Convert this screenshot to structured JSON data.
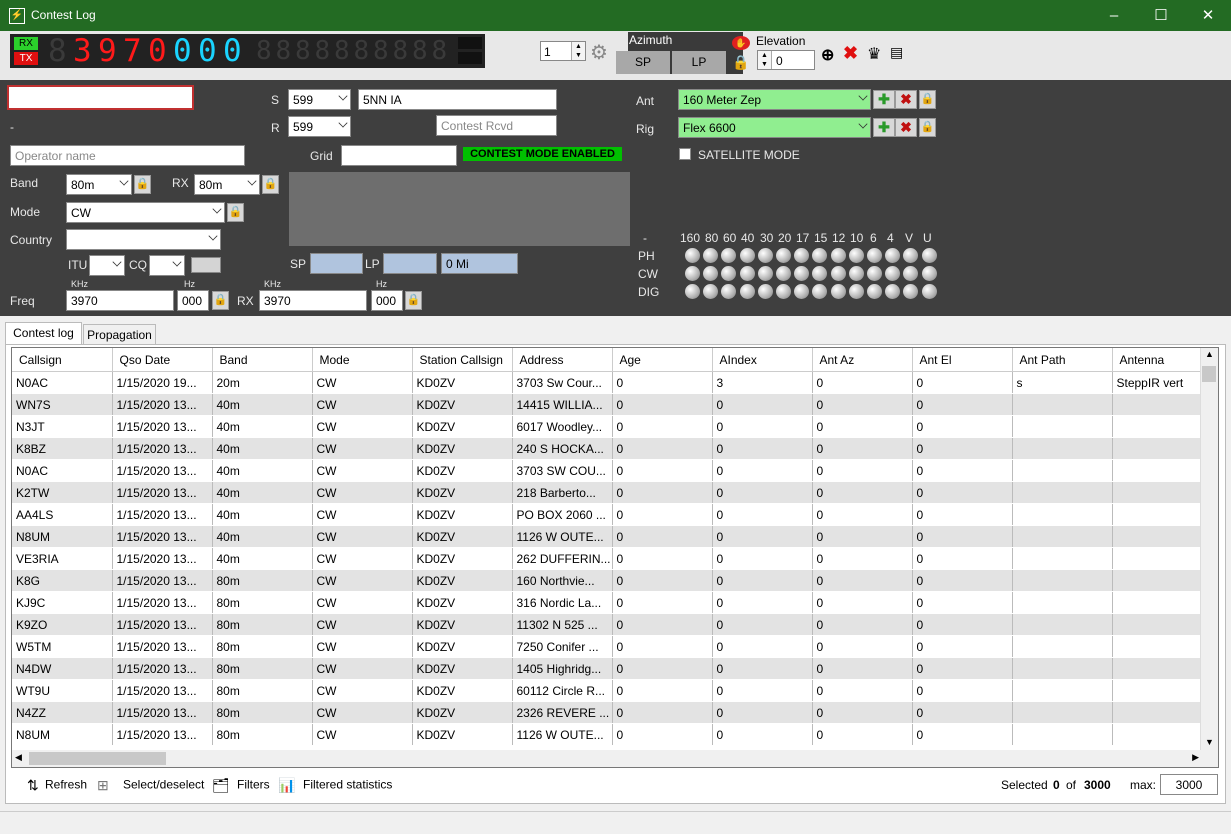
{
  "window": {
    "title": "Contest Log",
    "minimize": "–",
    "maximize": "☐",
    "close": "✕"
  },
  "vfo": {
    "rx_label": "RX",
    "tx_label": "TX",
    "main_digits": [
      "8",
      "3",
      "9",
      "7",
      "0",
      "0",
      "0",
      "0"
    ],
    "main_digit_colors": [
      "off",
      "red",
      "red",
      "red",
      "red",
      "cyan",
      "cyan",
      "cyan"
    ],
    "sub_digits": [
      "8",
      "8",
      "8",
      "8",
      "8",
      "8",
      "8",
      "8",
      "8",
      "8"
    ]
  },
  "toolbar": {
    "rotor_value": "1",
    "azimuth_label": "Azimuth",
    "sp_label": "SP",
    "lp_label": "LP",
    "elevation_label": "Elevation",
    "elevation_value": "0"
  },
  "entry": {
    "callsign_value": "",
    "dash_label": "-",
    "operator_placeholder": "Operator name",
    "band_label": "Band",
    "band_value": "80m",
    "rx_label": "RX",
    "rx_band_value": "80m",
    "mode_label": "Mode",
    "mode_value": "CW",
    "country_label": "Country",
    "country_value": "",
    "itu_label": "ITU",
    "cq_label": "CQ",
    "freq_label": "Freq",
    "khz_label": "KHz",
    "hz_label": "Hz",
    "freq_khz": "3970",
    "freq_hz": "000",
    "rx_freq_label": "RX",
    "rx_freq_khz": "3970",
    "rx_freq_hz": "000"
  },
  "report": {
    "s_label": "S",
    "s_value": "599",
    "r_label": "R",
    "r_value": "599",
    "exchange_sent": "5NN IA",
    "exchange_rcvd_placeholder": "Contest Rcvd",
    "grid_label": "Grid",
    "grid_value": "",
    "contest_mode": "CONTEST MODE ENABLED",
    "sp_label": "SP",
    "lp_label": "LP",
    "distance": "0 Mi"
  },
  "station": {
    "ant_label": "Ant",
    "ant_value": "160 Meter Zep",
    "rig_label": "Rig",
    "rig_value": "Flex 6600",
    "satellite_label": "SATELLITE MODE"
  },
  "band_matrix": {
    "dash": "-",
    "bands": [
      "160",
      "80",
      "60",
      "40",
      "30",
      "20",
      "17",
      "15",
      "12",
      "10",
      "6",
      "4",
      "V",
      "U"
    ],
    "modes": [
      "PH",
      "CW",
      "DIG"
    ]
  },
  "tabs": [
    {
      "label": "Contest log"
    },
    {
      "label": "Propagation"
    }
  ],
  "grid": {
    "columns": [
      "Callsign",
      "Qso Date",
      "Band",
      "Mode",
      "Station Callsign",
      "Address",
      "Age",
      "AIndex",
      "Ant Az",
      "Ant El",
      "Ant Path",
      "Antenna"
    ],
    "rows": [
      [
        "N0AC",
        "1/15/2020 19...",
        "20m",
        "CW",
        "KD0ZV",
        "3703 Sw Cour...",
        "0",
        "3",
        "0",
        "0",
        "s",
        "SteppIR vert"
      ],
      [
        "WN7S",
        "1/15/2020 13...",
        "40m",
        "CW",
        "KD0ZV",
        "14415 WILLIA...",
        "0",
        "0",
        "0",
        "0",
        "",
        ""
      ],
      [
        "N3JT",
        "1/15/2020 13...",
        "40m",
        "CW",
        "KD0ZV",
        "6017 Woodley...",
        "0",
        "0",
        "0",
        "0",
        "",
        ""
      ],
      [
        "K8BZ",
        "1/15/2020 13...",
        "40m",
        "CW",
        "KD0ZV",
        "240 S HOCKA...",
        "0",
        "0",
        "0",
        "0",
        "",
        ""
      ],
      [
        "N0AC",
        "1/15/2020 13...",
        "40m",
        "CW",
        "KD0ZV",
        "3703 SW COU...",
        "0",
        "0",
        "0",
        "0",
        "",
        ""
      ],
      [
        "K2TW",
        "1/15/2020 13...",
        "40m",
        "CW",
        "KD0ZV",
        "218 Barberto...",
        "0",
        "0",
        "0",
        "0",
        "",
        ""
      ],
      [
        "AA4LS",
        "1/15/2020 13...",
        "40m",
        "CW",
        "KD0ZV",
        "PO BOX 2060 ...",
        "0",
        "0",
        "0",
        "0",
        "",
        ""
      ],
      [
        "N8UM",
        "1/15/2020 13...",
        "40m",
        "CW",
        "KD0ZV",
        "1126 W OUTE...",
        "0",
        "0",
        "0",
        "0",
        "",
        ""
      ],
      [
        "VE3RIA",
        "1/15/2020 13...",
        "40m",
        "CW",
        "KD0ZV",
        "262 DUFFERIN...",
        "0",
        "0",
        "0",
        "0",
        "",
        ""
      ],
      [
        "K8G",
        "1/15/2020 13...",
        "80m",
        "CW",
        "KD0ZV",
        "160 Northvie...",
        "0",
        "0",
        "0",
        "0",
        "",
        ""
      ],
      [
        "KJ9C",
        "1/15/2020 13...",
        "80m",
        "CW",
        "KD0ZV",
        "316 Nordic La...",
        "0",
        "0",
        "0",
        "0",
        "",
        ""
      ],
      [
        "K9ZO",
        "1/15/2020 13...",
        "80m",
        "CW",
        "KD0ZV",
        "11302 N 525 ...",
        "0",
        "0",
        "0",
        "0",
        "",
        ""
      ],
      [
        "W5TM",
        "1/15/2020 13...",
        "80m",
        "CW",
        "KD0ZV",
        "7250 Conifer ...",
        "0",
        "0",
        "0",
        "0",
        "",
        ""
      ],
      [
        "N4DW",
        "1/15/2020 13...",
        "80m",
        "CW",
        "KD0ZV",
        "1405 Highridg...",
        "0",
        "0",
        "0",
        "0",
        "",
        ""
      ],
      [
        "WT9U",
        "1/15/2020 13...",
        "80m",
        "CW",
        "KD0ZV",
        "60112 Circle R...",
        "0",
        "0",
        "0",
        "0",
        "",
        ""
      ],
      [
        "N4ZZ",
        "1/15/2020 13...",
        "80m",
        "CW",
        "KD0ZV",
        "2326 REVERE ...",
        "0",
        "0",
        "0",
        "0",
        "",
        ""
      ],
      [
        "N8UM",
        "1/15/2020 13...",
        "80m",
        "CW",
        "KD0ZV",
        "1126 W OUTE...",
        "0",
        "0",
        "0",
        "0",
        "",
        ""
      ]
    ]
  },
  "statusbar": {
    "refresh": "Refresh",
    "select_deselect": "Select/deselect",
    "filters": "Filters",
    "filtered_statistics": "Filtered statistics",
    "selected_label": "Selected",
    "selected_count": "0",
    "of_label": "of",
    "total_count": "3000",
    "max_label": "max:",
    "max_value": "3000"
  },
  "colors": {
    "titlebar": "#236b23",
    "panel": "#3f3f3f",
    "field_green": "#90ee90",
    "contest_mode": "#00c000",
    "lcd_red": "#ff1a1a",
    "lcd_cyan": "#1ad4ff"
  }
}
